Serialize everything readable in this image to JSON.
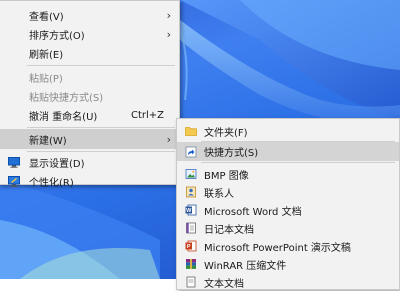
{
  "context_menu": {
    "items": [
      {
        "label": "查看(V)",
        "has_submenu": true
      },
      {
        "label": "排序方式(O)",
        "has_submenu": true
      },
      {
        "label": "刷新(E)"
      },
      {
        "label": "粘贴(P)",
        "disabled": true
      },
      {
        "label": "粘贴快捷方式(S)",
        "disabled": true
      },
      {
        "label": "撤消 重命名(U)",
        "shortcut": "Ctrl+Z"
      },
      {
        "label": "新建(W)",
        "has_submenu": true,
        "highlighted": true
      },
      {
        "label": "显示设置(D)",
        "icon": "display-settings-icon"
      },
      {
        "label": "个性化(R)",
        "icon": "personalize-icon"
      }
    ]
  },
  "new_submenu": {
    "items": [
      {
        "label": "文件夹(F)",
        "icon": "folder-icon"
      },
      {
        "label": "快捷方式(S)",
        "icon": "shortcut-icon",
        "highlighted": true
      },
      {
        "label": "BMP 图像",
        "icon": "bmp-image-icon"
      },
      {
        "label": "联系人",
        "icon": "contact-icon"
      },
      {
        "label": "Microsoft Word 文档",
        "icon": "word-document-icon"
      },
      {
        "label": "日记本文档",
        "icon": "journal-document-icon"
      },
      {
        "label": "Microsoft PowerPoint 演示文稿",
        "icon": "powerpoint-icon"
      },
      {
        "label": "WinRAR 压缩文件",
        "icon": "winrar-icon"
      },
      {
        "label": "文本文档",
        "icon": "text-document-icon"
      }
    ]
  },
  "annotation": {
    "color": "#e8322e",
    "icon": "red-arrow-annotation"
  },
  "colors": {
    "desktop_blue": "#2b6fe6",
    "menu_bg": "#f2f2f2",
    "highlight": "#cfcfcf"
  }
}
